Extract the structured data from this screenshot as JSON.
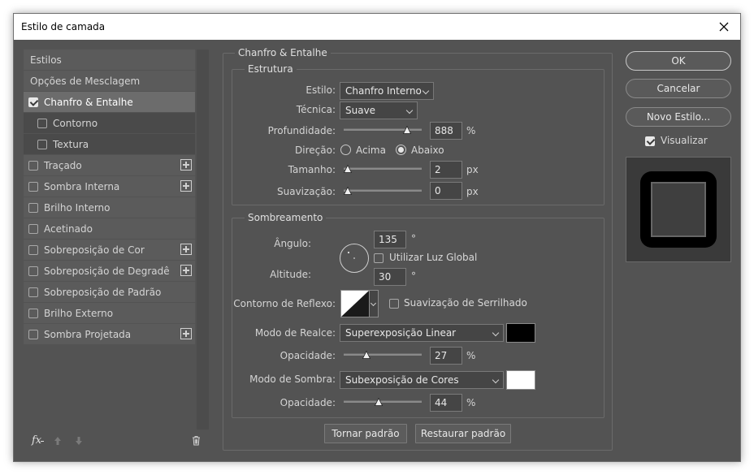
{
  "window": {
    "title": "Estilo de camada"
  },
  "left_panel": {
    "items": [
      {
        "label": "Estilos",
        "checkbox": false,
        "checked": false,
        "plus": false,
        "selected": false,
        "sub": false
      },
      {
        "label": "Opções de Mesclagem",
        "checkbox": false,
        "checked": false,
        "plus": false,
        "selected": false,
        "sub": false
      },
      {
        "label": "Chanfro & Entalhe",
        "checkbox": true,
        "checked": true,
        "plus": false,
        "selected": true,
        "sub": false
      },
      {
        "label": "Contorno",
        "checkbox": true,
        "checked": false,
        "plus": false,
        "selected": false,
        "sub": true
      },
      {
        "label": "Textura",
        "checkbox": true,
        "checked": false,
        "plus": false,
        "selected": false,
        "sub": true
      },
      {
        "label": "Traçado",
        "checkbox": true,
        "checked": false,
        "plus": true,
        "selected": false,
        "sub": false
      },
      {
        "label": "Sombra Interna",
        "checkbox": true,
        "checked": false,
        "plus": true,
        "selected": false,
        "sub": false
      },
      {
        "label": "Brilho Interno",
        "checkbox": true,
        "checked": false,
        "plus": false,
        "selected": false,
        "sub": false
      },
      {
        "label": "Acetinado",
        "checkbox": true,
        "checked": false,
        "plus": false,
        "selected": false,
        "sub": false
      },
      {
        "label": "Sobreposição de Cor",
        "checkbox": true,
        "checked": false,
        "plus": true,
        "selected": false,
        "sub": false
      },
      {
        "label": "Sobreposição de Degradê",
        "checkbox": true,
        "checked": false,
        "plus": true,
        "selected": false,
        "sub": false
      },
      {
        "label": "Sobreposição de Padrão",
        "checkbox": true,
        "checked": false,
        "plus": false,
        "selected": false,
        "sub": false
      },
      {
        "label": "Brilho Externo",
        "checkbox": true,
        "checked": false,
        "plus": false,
        "selected": false,
        "sub": false
      },
      {
        "label": "Sombra Projetada",
        "checkbox": true,
        "checked": false,
        "plus": true,
        "selected": false,
        "sub": false
      }
    ],
    "tools": {
      "fx_label": "fx"
    }
  },
  "bevel": {
    "section_title": "Chanfro & Entalhe",
    "structure": {
      "title": "Estrutura",
      "style_label": "Estilo:",
      "style_value": "Chanfro Interno",
      "technique_label": "Técnica:",
      "technique_value": "Suave",
      "depth_label": "Profundidade:",
      "depth_value": "888",
      "depth_unit": "%",
      "depth_slider": 0.85,
      "direction_label": "Direção:",
      "direction_up": "Acima",
      "direction_down": "Abaixo",
      "direction_selected": "Abaixo",
      "size_label": "Tamanho:",
      "size_value": "2",
      "size_unit": "px",
      "size_slider": 0.0,
      "soften_label": "Suavização:",
      "soften_value": "0",
      "soften_unit": "px",
      "soften_slider": 0.0
    },
    "shading": {
      "title": "Sombreamento",
      "angle_label": "Ângulo:",
      "angle_value": "135",
      "angle_unit": "°",
      "global_light_label": "Utilizar Luz Global",
      "global_light_checked": false,
      "altitude_label": "Altitude:",
      "altitude_value": "30",
      "altitude_unit": "°",
      "gloss_label": "Contorno de Reflexo:",
      "antialias_label": "Suavização de Serrilhado",
      "antialias_checked": false,
      "highlight_mode_label": "Modo de Realce:",
      "highlight_mode_value": "Superexposição Linear",
      "highlight_color": "#000000",
      "highlight_opacity_label": "Opacidade:",
      "highlight_opacity_value": "27",
      "highlight_opacity_unit": "%",
      "highlight_opacity_slider": 0.27,
      "shadow_mode_label": "Modo de Sombra:",
      "shadow_mode_value": "Subexposição de Cores",
      "shadow_color": "#ffffff",
      "shadow_opacity_label": "Opacidade:",
      "shadow_opacity_value": "44",
      "shadow_opacity_unit": "%",
      "shadow_opacity_slider": 0.44
    },
    "make_default": "Tornar padrão",
    "reset_default": "Restaurar padrão"
  },
  "right": {
    "ok": "OK",
    "cancel": "Cancelar",
    "new_style": "Novo Estilo...",
    "preview_label": "Visualizar",
    "preview_checked": true
  }
}
